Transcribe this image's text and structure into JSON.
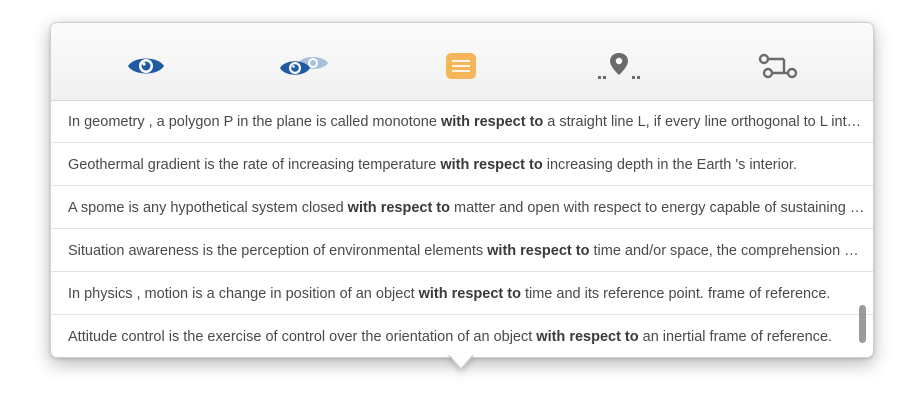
{
  "toolbar": {
    "tools": [
      {
        "name": "eye-icon",
        "color": "#1f5aa3"
      },
      {
        "name": "eye-compare-icon",
        "color": "#1f5aa3"
      },
      {
        "name": "note-icon",
        "color": "#f5b65a"
      },
      {
        "name": "location-pin-icon",
        "color": "#6b6b6b"
      },
      {
        "name": "workflow-icon",
        "color": "#6b6b6b"
      }
    ]
  },
  "results": [
    {
      "before": "In geometry , a polygon  P in the plane is called monotone ",
      "keyword": "with respect to",
      "after": " a straight line L, if every line orthogonal to L intersects the boundary of P at most twice."
    },
    {
      "before": "Geothermal gradient is the rate of increasing temperature ",
      "keyword": "with respect to",
      "after": " increasing depth in the Earth 's interior."
    },
    {
      "before": "A spome is any hypothetical  system closed ",
      "keyword": "with respect to",
      "after": " matter and open with respect to energy capable of sustaining life."
    },
    {
      "before": "Situation awareness is the perception of environmental elements ",
      "keyword": "with respect to",
      "after": " time and/or space, the comprehension of their meaning."
    },
    {
      "before": "In physics , motion is a change in position  of an object ",
      "keyword": "with respect to",
      "after": " time and its reference point.  frame of reference."
    },
    {
      "before": "Attitude control is the exercise of control over the orientation of an object ",
      "keyword": "with respect to",
      "after": " an inertial frame of reference."
    }
  ]
}
